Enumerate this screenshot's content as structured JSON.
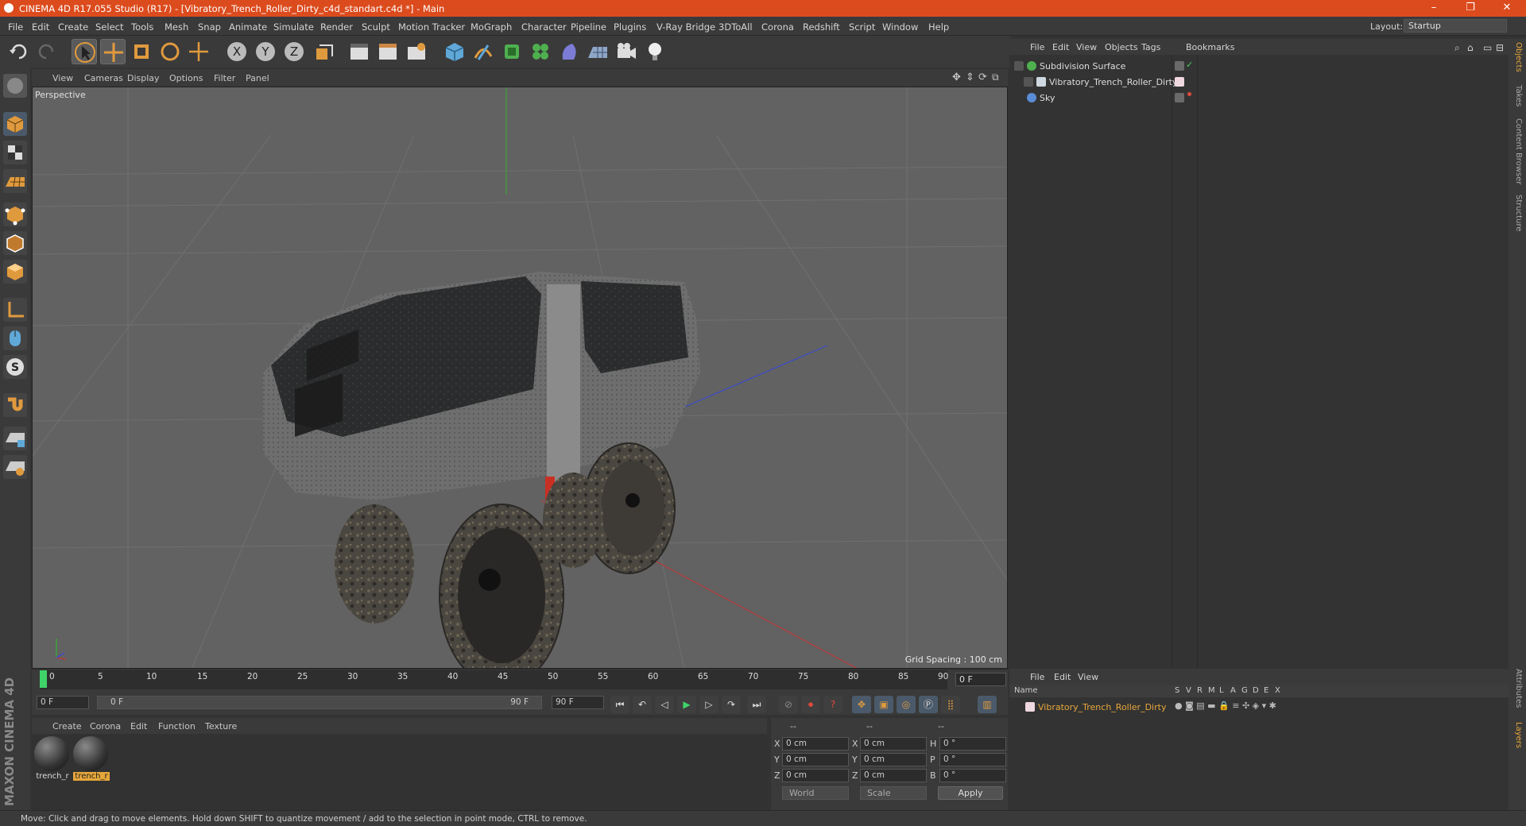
{
  "window": {
    "title": "CINEMA 4D R17.055 Studio (R17) - [Vibratory_Trench_Roller_Dirty_c4d_standart.c4d *] - Main",
    "controls": [
      "–",
      "❐",
      "✕"
    ]
  },
  "menubar": {
    "items": [
      "File",
      "Edit",
      "Create",
      "Select",
      "Tools",
      "Mesh",
      "Snap",
      "Animate",
      "Simulate",
      "Render",
      "Sculpt",
      "Motion Tracker",
      "MoGraph",
      "Character",
      "Pipeline",
      "Plugins",
      "V-Ray Bridge",
      "3DToAll",
      "Corona",
      "Redshift",
      "Script",
      "Window",
      "Help"
    ],
    "layout_label": "Layout:",
    "layout_value": "Startup"
  },
  "viewport": {
    "menu": [
      "View",
      "Cameras",
      "Display",
      "Options",
      "Filter",
      "Panel"
    ],
    "label": "Perspective",
    "grid_spacing": "Grid Spacing : 100 cm"
  },
  "timeline": {
    "ticks": [
      "0",
      "5",
      "10",
      "15",
      "20",
      "25",
      "30",
      "35",
      "40",
      "45",
      "50",
      "55",
      "60",
      "65",
      "70",
      "75",
      "80",
      "85",
      "90"
    ],
    "end_frame": "0 F"
  },
  "transport": {
    "current": "0 F",
    "range_start": "0 F",
    "range_end": "90 F",
    "max": "90 F"
  },
  "materials": {
    "menu": [
      "Create",
      "Corona",
      "Edit",
      "Function",
      "Texture"
    ],
    "items": [
      {
        "label": "trench_r"
      },
      {
        "label": "trench_r"
      }
    ]
  },
  "coordinates": {
    "rows": [
      {
        "a1": "X",
        "v1": "0 cm",
        "a2": "X",
        "v2": "0 cm",
        "a3": "H",
        "v3": "0 °"
      },
      {
        "a1": "Y",
        "v1": "0 cm",
        "a2": "Y",
        "v2": "0 cm",
        "a3": "P",
        "v3": "0 °"
      },
      {
        "a1": "Z",
        "v1": "0 cm",
        "a2": "Z",
        "v2": "0 cm",
        "a3": "B",
        "v3": "0 °"
      }
    ],
    "world": "World",
    "scale": "Scale",
    "apply": "Apply",
    "header1": "--",
    "header2": "--",
    "header3": "--"
  },
  "objects": {
    "menu": [
      "File",
      "Edit",
      "View",
      "Objects",
      "Tags",
      "Bookmarks"
    ],
    "items": [
      {
        "name": "Subdivision Surface",
        "color": "#4fb04f"
      },
      {
        "name": "Vibratory_Trench_Roller_Dirty",
        "color": "#cfd8e0"
      },
      {
        "name": "Sky",
        "color": "#5b8cd6"
      }
    ]
  },
  "layers": {
    "menu": [
      "File",
      "Edit",
      "View"
    ],
    "columns": [
      "Name",
      "S",
      "V",
      "R",
      "M",
      "L",
      "A",
      "G",
      "D",
      "E",
      "X"
    ],
    "items": [
      {
        "name": "Vibratory_Trench_Roller_Dirty",
        "color": "#e6a73a"
      }
    ]
  },
  "right_tabs": [
    "Objects",
    "Takes",
    "Content Browser",
    "Structure",
    "Attributes",
    "Layers"
  ],
  "status": "Move: Click and drag to move elements. Hold down SHIFT to quantize movement / add to the selection in point mode, CTRL to remove.",
  "brand": "MAXON CINEMA 4D",
  "colors": {
    "accent": "#dc4b1d",
    "selection": "#e6a73a"
  }
}
